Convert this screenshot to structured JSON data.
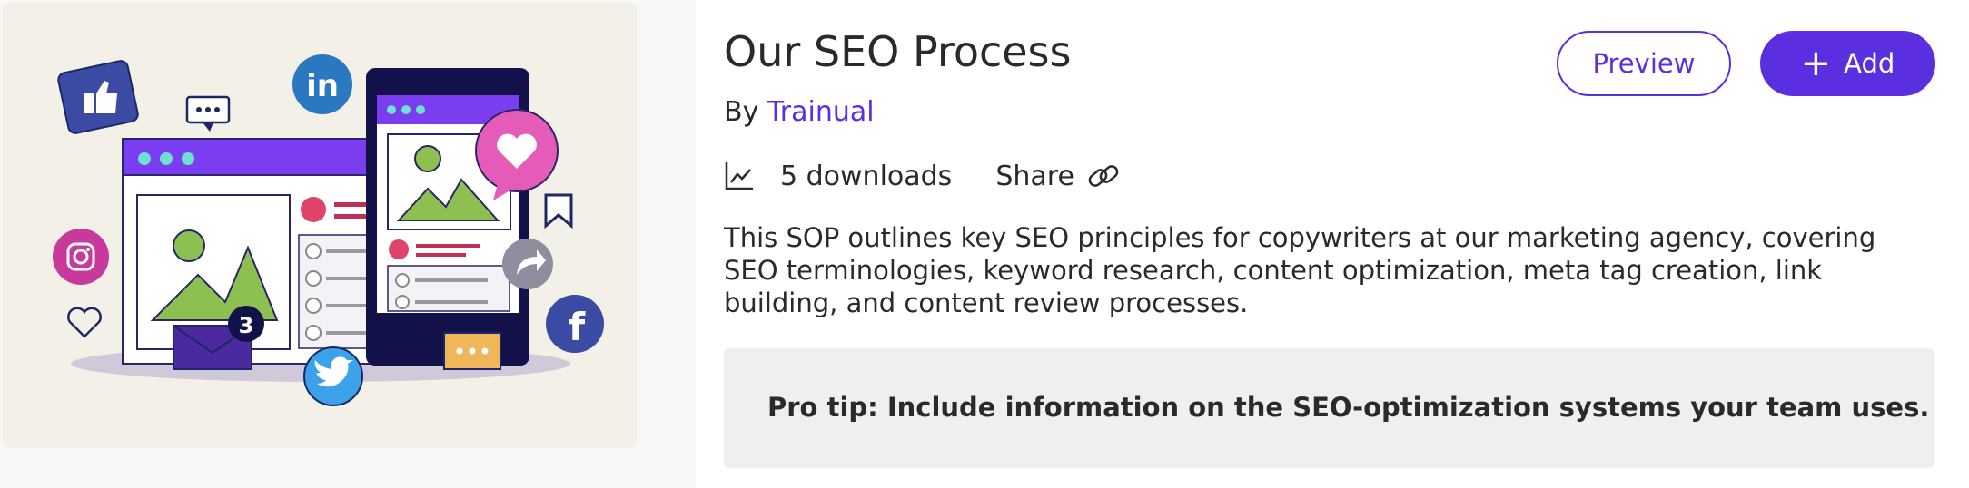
{
  "template": {
    "title": "Our SEO Process",
    "byline_prefix": "By",
    "author": "Trainual",
    "downloads": "5 downloads",
    "share_label": "Share",
    "description": "This SOP outlines key SEO principles for copywriters at our marketing agency, covering SEO terminologies, keyword research, content optimization, meta tag creation, link building, and content review processes.",
    "pro_tip": "Pro tip: Include information on the SEO-optimization systems your team uses."
  },
  "actions": {
    "preview_label": "Preview",
    "add_label": "Add",
    "add_icon": "plus-icon"
  },
  "hero": {
    "notification_count": "3",
    "icons": [
      "thumbs-up-icon",
      "chat-icon",
      "linkedin-icon",
      "instagram-icon",
      "heart-icon",
      "bookmark-icon",
      "share-arrow-icon",
      "facebook-icon",
      "twitter-icon",
      "mail-icon"
    ]
  },
  "colors": {
    "accent": "#5b2ee0",
    "hero_bg": "#f3f0e8",
    "tip_bg": "#efefef"
  }
}
